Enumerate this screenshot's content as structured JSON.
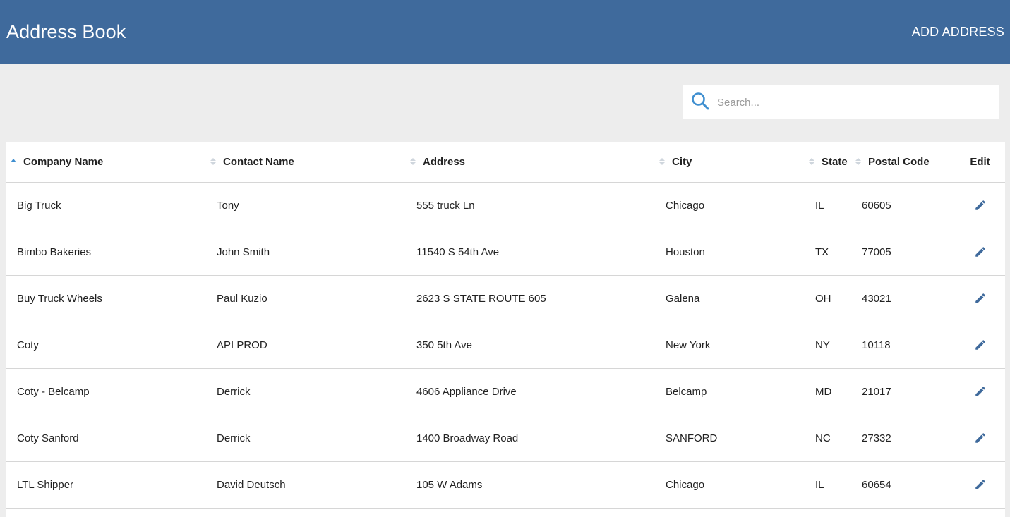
{
  "header": {
    "title": "Address Book",
    "add_label": "ADD ADDRESS"
  },
  "search": {
    "placeholder": "Search...",
    "value": ""
  },
  "colors": {
    "appbar": "#3f6a9c",
    "accent": "#3f6a9c",
    "background": "#ededed"
  },
  "table": {
    "columns": [
      "Company Name",
      "Contact Name",
      "Address",
      "City",
      "State",
      "Postal Code",
      "Edit"
    ],
    "sorted_column": "Company Name",
    "sort_direction": "ascending",
    "rows": [
      [
        "Big Truck",
        "Tony",
        "555 truck Ln",
        "Chicago",
        "IL",
        "60605"
      ],
      [
        "Bimbo Bakeries",
        "John Smith",
        "11540 S 54th Ave",
        "Houston",
        "TX",
        "77005"
      ],
      [
        "Buy Truck Wheels",
        "Paul Kuzio",
        "2623 S STATE ROUTE 605",
        "Galena",
        "OH",
        "43021"
      ],
      [
        "Coty",
        "API PROD",
        "350 5th Ave",
        "New York",
        "NY",
        "10118"
      ],
      [
        "Coty - Belcamp",
        "Derrick",
        "4606 Appliance Drive",
        "Belcamp",
        "MD",
        "21017"
      ],
      [
        "Coty Sanford",
        "Derrick",
        "1400 Broadway Road",
        "SANFORD",
        "NC",
        "27332"
      ],
      [
        "LTL Shipper",
        "David Deutsch",
        "105 W Adams",
        "Chicago",
        "IL",
        "60654"
      ]
    ],
    "row_action_icon": "pencil-icon"
  }
}
